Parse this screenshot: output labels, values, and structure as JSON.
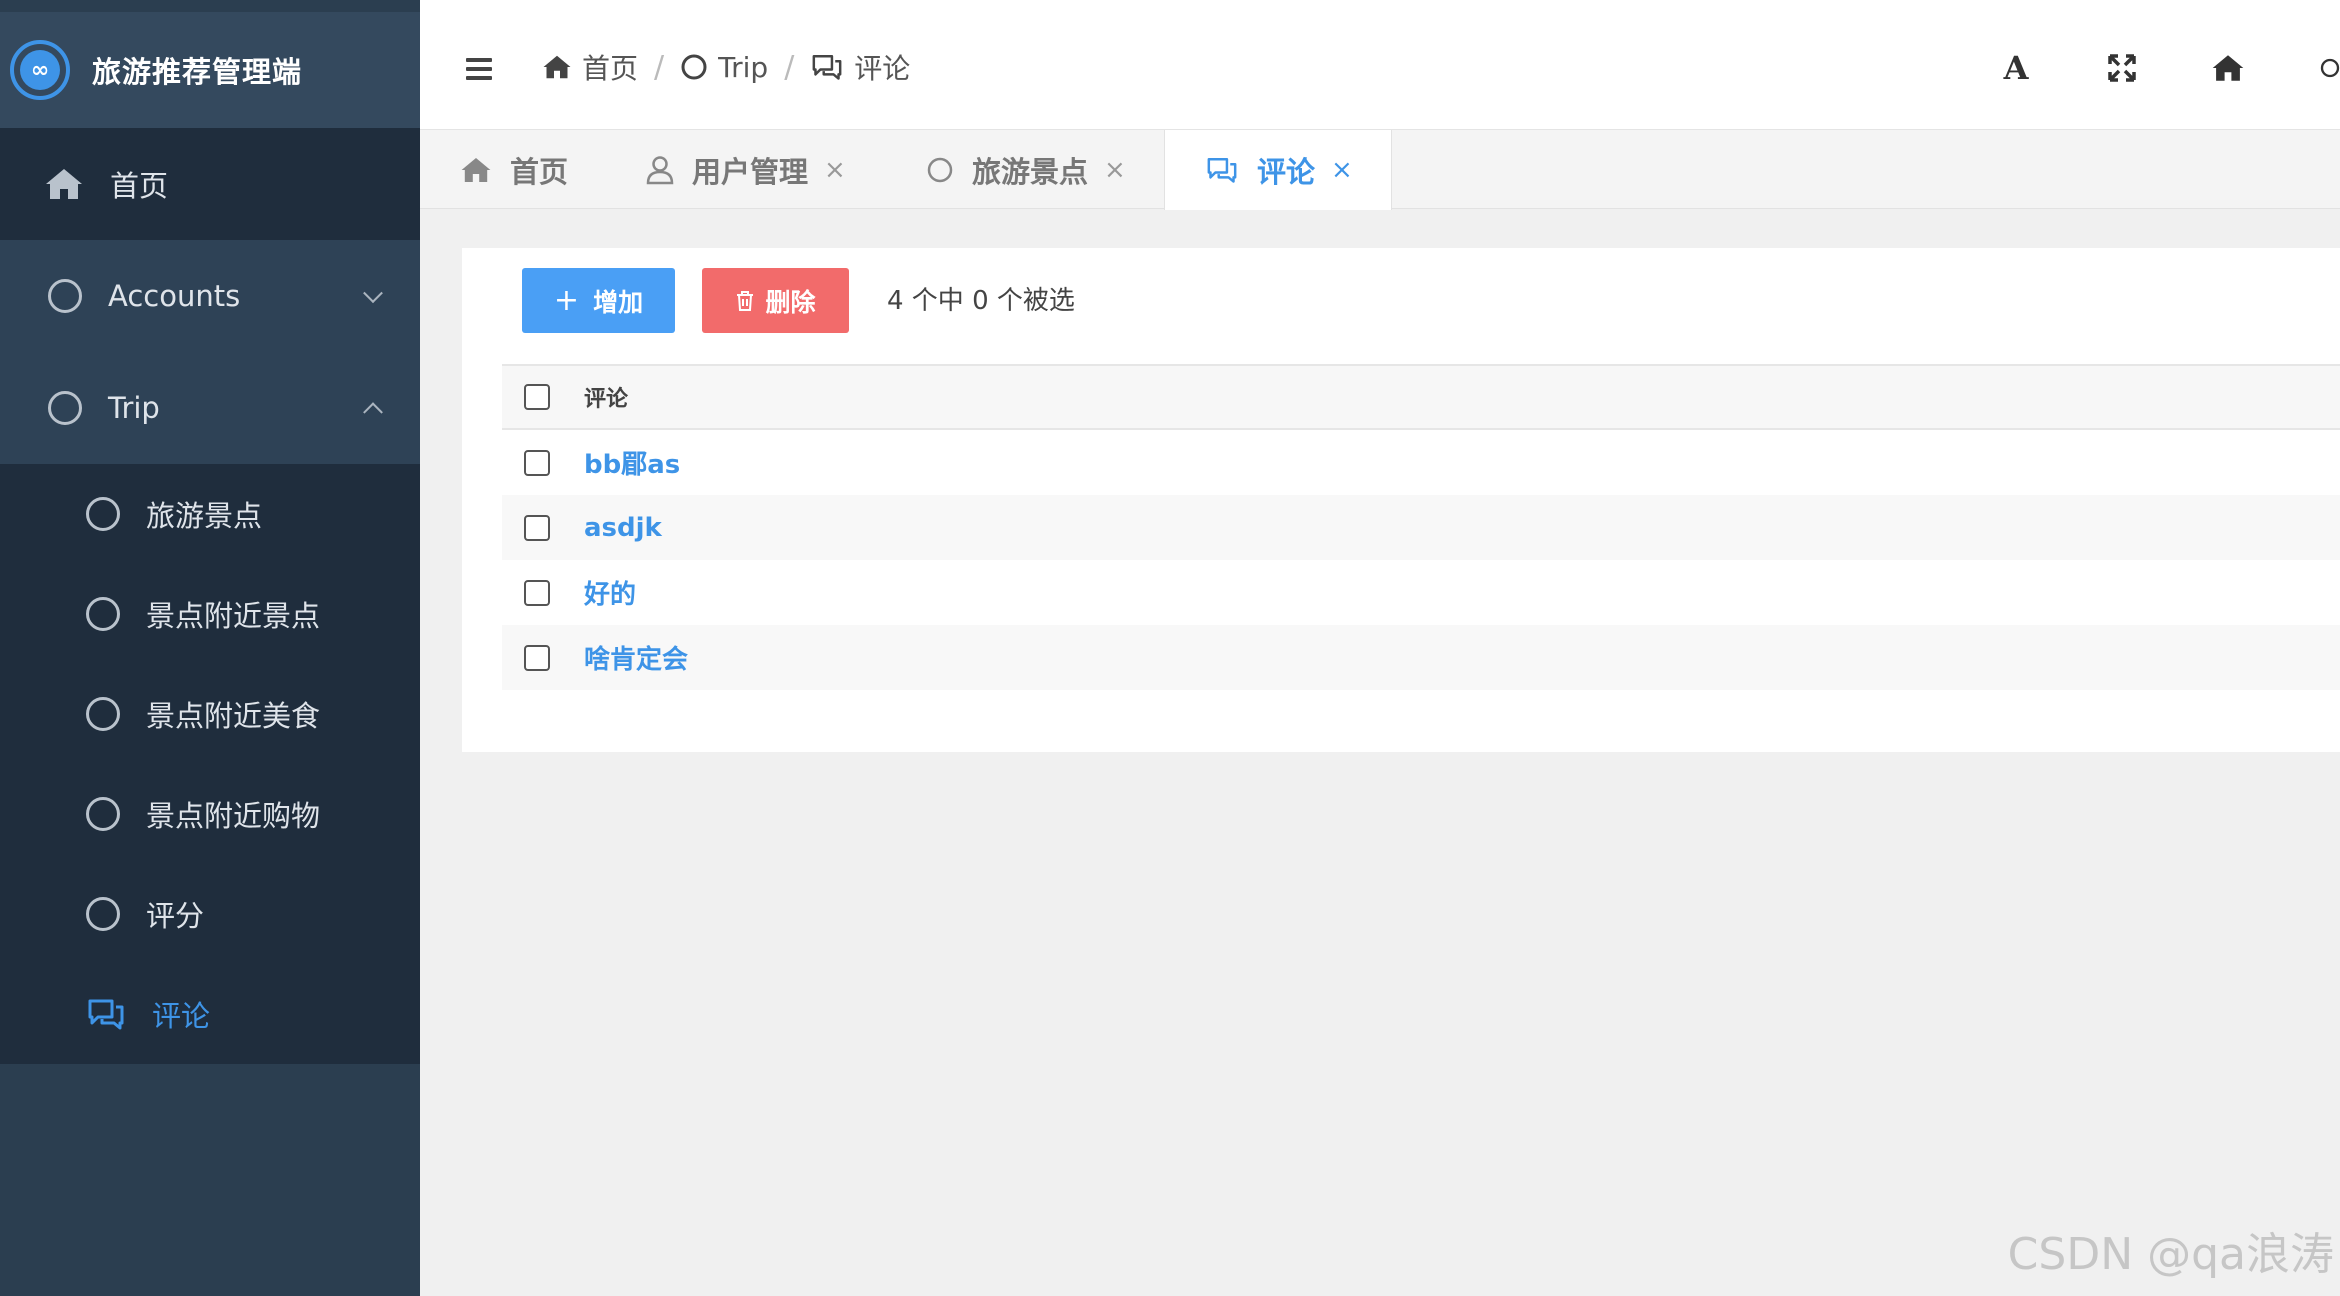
{
  "app": {
    "title": "旅游推荐管理端"
  },
  "sidebar": {
    "items": [
      {
        "label": "首页",
        "icon": "home-icon"
      },
      {
        "label": "Accounts",
        "icon": "circle-icon"
      },
      {
        "label": "Trip",
        "icon": "circle-icon"
      }
    ],
    "sub_items": [
      {
        "label": "旅游景点",
        "icon": "circle-icon"
      },
      {
        "label": "景点附近景点",
        "icon": "circle-icon"
      },
      {
        "label": "景点附近美食",
        "icon": "circle-icon"
      },
      {
        "label": "景点附近购物",
        "icon": "circle-icon"
      },
      {
        "label": "评分",
        "icon": "circle-icon"
      },
      {
        "label": "评论",
        "icon": "comments-icon"
      }
    ]
  },
  "header": {
    "breadcrumb": [
      {
        "label": "首页",
        "icon": "home-icon"
      },
      {
        "label": "Trip",
        "icon": "circle-icon"
      },
      {
        "label": "评论",
        "icon": "comments-icon"
      }
    ],
    "separator": "/",
    "font_button": "A"
  },
  "tabs": [
    {
      "label": "首页",
      "icon": "home-icon",
      "closable": false
    },
    {
      "label": "用户管理",
      "icon": "user-icon",
      "closable": true
    },
    {
      "label": "旅游景点",
      "icon": "circle-icon",
      "closable": true
    },
    {
      "label": "评论",
      "icon": "comments-icon",
      "closable": true,
      "active": true
    }
  ],
  "tab_close_glyph": "×",
  "toolbar": {
    "add_label": "增加",
    "add_glyph": "+",
    "delete_label": "删除",
    "selection_text": "4 个中 0 个被选"
  },
  "table": {
    "header": "评论",
    "rows": [
      "bb郿as",
      "asdjk",
      "好的",
      "啥肯定会"
    ]
  },
  "watermark": "CSDN @qa浪涛",
  "colors": {
    "accent": "#3e94e7",
    "sidebar_bg": "#2b3e50",
    "sidebar_dark": "#1f2d3d",
    "add_button": "#4a9ff5",
    "delete_button": "#f26b6b"
  }
}
